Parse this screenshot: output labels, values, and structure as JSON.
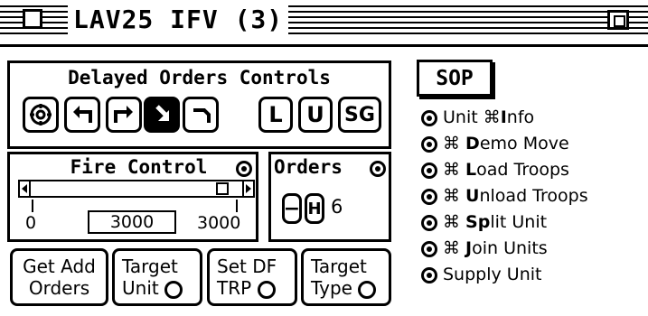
{
  "window": {
    "title": "LAV25 IFV (3)"
  },
  "delayed_orders": {
    "title": "Delayed Orders Controls",
    "icon_buttons": [
      "gear-icon",
      "turn-left-icon",
      "turn-right-icon",
      "download-icon",
      "bend-icon"
    ],
    "L": "L",
    "U": "U",
    "SG": "SG"
  },
  "fire_control": {
    "title": "Fire Control",
    "slider_value_fraction": 0.95,
    "min_label": "0",
    "value": "3000",
    "max_label": "3000"
  },
  "orders": {
    "title": "Orders",
    "minus": "−",
    "h": "H",
    "count": "6"
  },
  "bottom_buttons": [
    {
      "line1": "Get Add",
      "line2": "Orders"
    },
    {
      "line1": "Target",
      "line2": "Unit"
    },
    {
      "line1": "Set DF",
      "line2": "TRP"
    },
    {
      "line1": "Target",
      "line2": "Type"
    }
  ],
  "sop": {
    "title": "SOP",
    "items": [
      {
        "prefix": "Unit ⌘",
        "bold": "I",
        "rest": "nfo"
      },
      {
        "prefix": "⌘ ",
        "bold": "D",
        "rest": "emo Move"
      },
      {
        "prefix": "⌘ ",
        "bold": "L",
        "rest": "oad Troops"
      },
      {
        "prefix": "⌘ ",
        "bold": "U",
        "rest": "nload Troops"
      },
      {
        "prefix": "⌘ ",
        "bold": "Sp",
        "rest": "lit Unit"
      },
      {
        "prefix": "⌘ ",
        "bold": "J",
        "rest": "oin Units"
      },
      {
        "prefix": "",
        "bold": "",
        "rest": "Supply Unit"
      }
    ]
  }
}
